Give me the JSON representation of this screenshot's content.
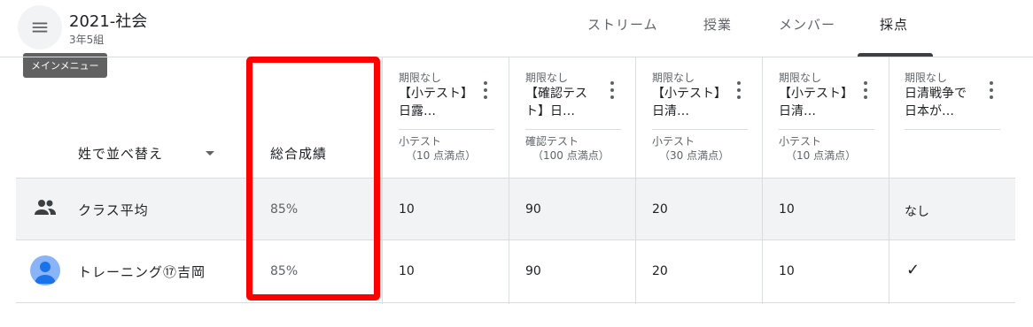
{
  "header": {
    "class_name": "2021-社会",
    "section": "3年5組",
    "menu_tooltip": "メインメニュー",
    "tabs": [
      "ストリーム",
      "授業",
      "メンバー",
      "採点"
    ]
  },
  "grid": {
    "sort_label": "姓で並べ替え",
    "overall_label": "総合成績",
    "assignments": [
      {
        "due": "期限なし",
        "title": "【小テスト】日露…",
        "topic": "小テスト",
        "points": "（10 点満点）"
      },
      {
        "due": "期限なし",
        "title": "【確認テスト】日…",
        "topic": "確認テスト",
        "points": "（100 点満点）"
      },
      {
        "due": "期限なし",
        "title": "【小テスト】日清…",
        "topic": "小テスト",
        "points": "（30 点満点）"
      },
      {
        "due": "期限なし",
        "title": "【小テスト】日清…",
        "topic": "小テスト",
        "points": "（10 点満点）"
      },
      {
        "due": "期限なし",
        "title": "日清戦争で日本が…",
        "topic": "",
        "points": ""
      }
    ],
    "class_average": {
      "label": "クラス平均",
      "overall": "85%",
      "scores": [
        "10",
        "90",
        "20",
        "10",
        "なし"
      ]
    },
    "students": [
      {
        "name": "トレーニング⑰吉岡",
        "overall": "85%",
        "scores": [
          "10",
          "90",
          "20",
          "10",
          "✓"
        ]
      }
    ]
  },
  "colors": {
    "highlight": "#ff0000",
    "row_background": "#f1f3f4",
    "avatar": "#8ab4f8"
  },
  "icons": {
    "menu": "hamburger-icon",
    "more": "more-vert-icon",
    "sort": "arrow-drop-down-icon",
    "class_average": "group-icon",
    "student": "account-circle-icon",
    "turned_in": "check-icon"
  }
}
